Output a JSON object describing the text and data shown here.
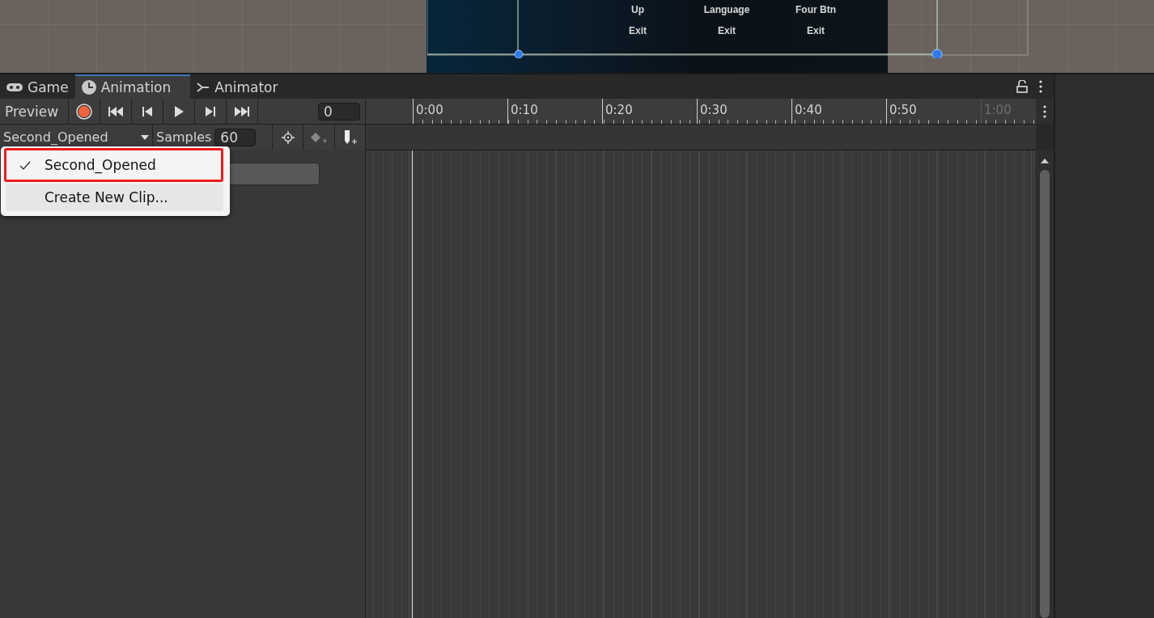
{
  "scene": {
    "columns": [
      {
        "labels": [
          "Up",
          "Exit"
        ]
      },
      {
        "labels": [
          "Language",
          "Exit"
        ]
      },
      {
        "labels": [
          "Four Btn",
          "Exit"
        ]
      }
    ]
  },
  "tabs": [
    {
      "label": "Game",
      "kind": "game",
      "selected": false
    },
    {
      "label": "Animation",
      "kind": "animation",
      "selected": true
    },
    {
      "label": "Animator",
      "kind": "animator",
      "selected": false
    }
  ],
  "toolbar": {
    "preview": "Preview",
    "frame": "0"
  },
  "clip": {
    "name": "Second_Opened",
    "samples_label": "Samples",
    "samples": "60"
  },
  "timeline": {
    "ticks": [
      {
        "label": "0:00",
        "dimmed": false
      },
      {
        "label": "0:10",
        "dimmed": false
      },
      {
        "label": "0:20",
        "dimmed": false
      },
      {
        "label": "0:30",
        "dimmed": false
      },
      {
        "label": "0:40",
        "dimmed": false
      },
      {
        "label": "0:50",
        "dimmed": false
      },
      {
        "label": "1:00",
        "dimmed": true
      }
    ]
  },
  "dropdown": {
    "items": [
      {
        "label": "Second_Opened",
        "selected": true,
        "hovered": false
      },
      {
        "label": "Create New Clip...",
        "selected": false,
        "hovered": true
      }
    ]
  }
}
